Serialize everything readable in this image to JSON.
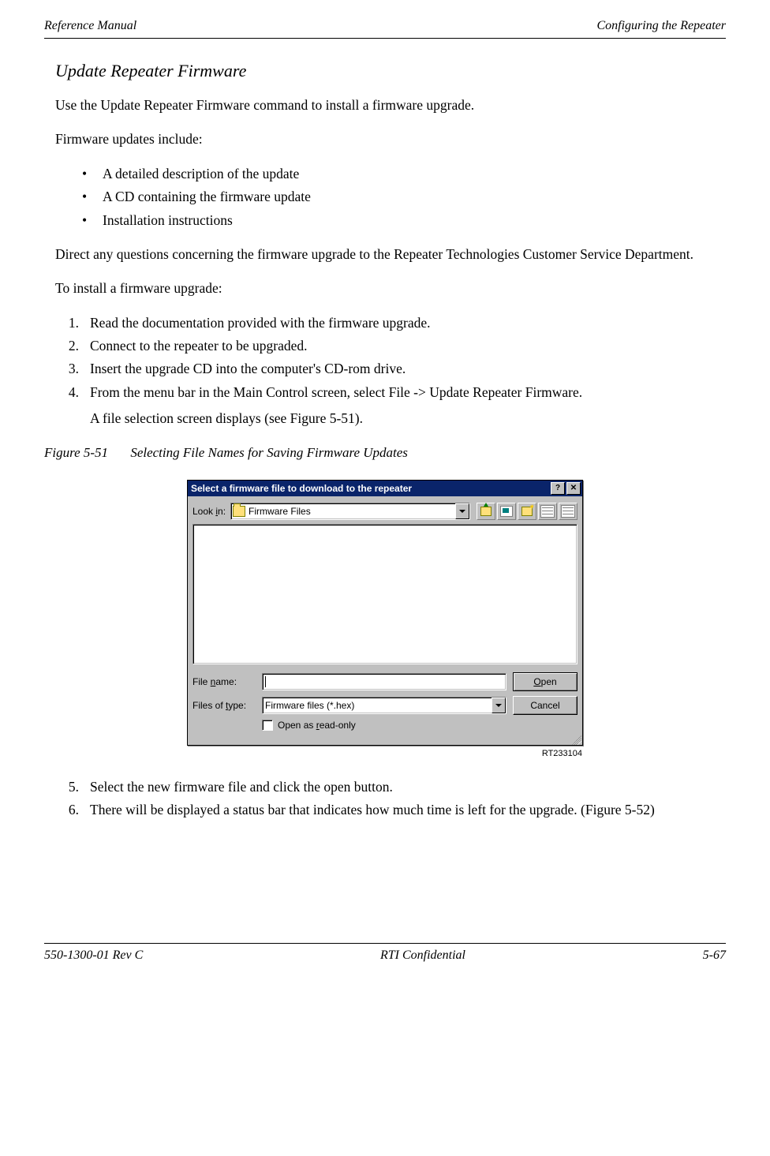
{
  "header": {
    "left": "Reference Manual",
    "right": "Configuring the Repeater"
  },
  "footer": {
    "left": "550-1300-01 Rev C",
    "center": "RTI Confidential",
    "right": "5-67"
  },
  "section_title": "Update Repeater Firmware",
  "intro_para": "Use the Update Repeater Firmware command to install a firmware upgrade.",
  "includes_intro": "Firmware updates include:",
  "bullets": [
    "A detailed description of the update",
    "A CD containing the firmware update",
    "Installation instructions"
  ],
  "para_direct": "Direct any questions concerning the firmware upgrade to the Repeater Technologies Customer Service Department.",
  "para_install": "To install a firmware upgrade:",
  "steps_a": [
    {
      "n": "1.",
      "t": "Read the documentation provided with the firmware upgrade."
    },
    {
      "n": "2.",
      "t": "Connect to the repeater to be upgraded."
    },
    {
      "n": "3.",
      "t": "Insert the upgrade CD into the computer's CD-rom drive."
    },
    {
      "n": "4.",
      "t": "From the menu bar in the Main Control screen, select File -> Update Repeater Firmware.",
      "sub": "A file selection screen displays (see Figure 5-51)."
    }
  ],
  "figure": {
    "num": "Figure 5-51",
    "title": "Selecting File Names for Saving Firmware Updates"
  },
  "dialog": {
    "title": "Select a firmware file to download to the repeater",
    "lookin_label": "Look in:",
    "lookin_value": "Firmware Files",
    "filename_label": "File name:",
    "filename_value": "",
    "filetype_label": "Files of type:",
    "filetype_value": "Firmware files (*.hex)",
    "open_btn": "Open",
    "cancel_btn": "Cancel",
    "readonly_label": "Open as read-only"
  },
  "rt_code": "RT233104",
  "steps_b": [
    {
      "n": "5.",
      "t": "Select the new firmware file and click the open button."
    },
    {
      "n": "6.",
      "t": "There will be displayed a status bar that indicates how much time is left for the upgrade. (Figure 5-52)"
    }
  ]
}
